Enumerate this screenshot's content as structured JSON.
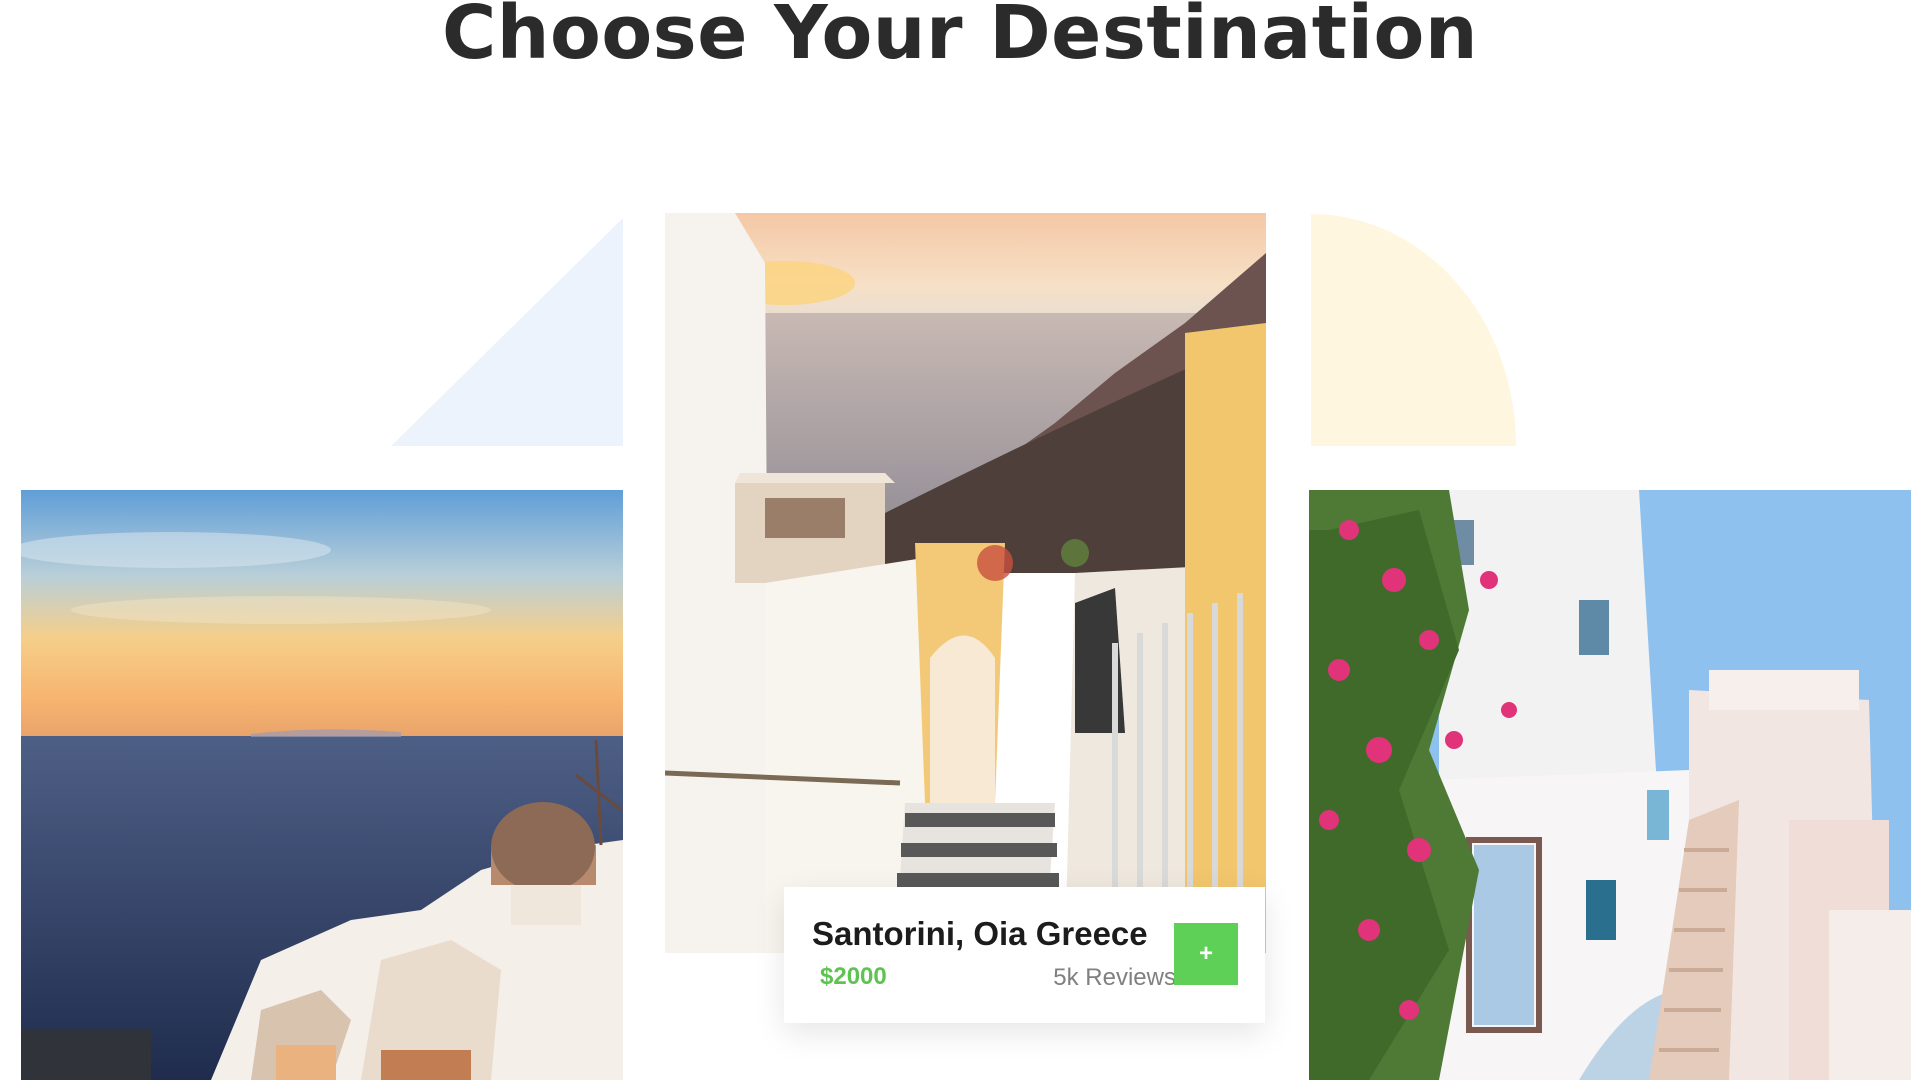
{
  "section": {
    "title": "Choose Your Destination"
  },
  "destinations": [
    {
      "image": "santorini-sunset-sea-photo"
    },
    {
      "image": "santorini-stairway-photo"
    },
    {
      "image": "santorini-white-houses-photo"
    }
  ],
  "featured_card": {
    "name": "Santorini, Oia Greece",
    "price": "$2000",
    "reviews": "5k Reviews",
    "button_icon": "+",
    "accent_color": "#5fd057",
    "price_color": "#5cc44f"
  }
}
